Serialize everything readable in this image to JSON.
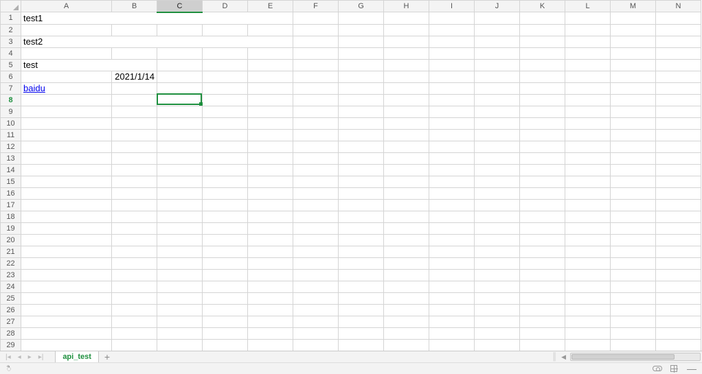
{
  "columns": [
    "A",
    "B",
    "C",
    "D",
    "E",
    "F",
    "G",
    "H",
    "I",
    "J",
    "K",
    "L",
    "M",
    "N"
  ],
  "col_widths": {
    "default": 66,
    "row_header": 30,
    "A": 132
  },
  "row_count": 29,
  "selection": {
    "col_index": 2,
    "row": 8
  },
  "cells": {
    "A1": {
      "value": "test1",
      "merge_cols": 5
    },
    "A3": {
      "value": "test2",
      "merge_cols": 5
    },
    "A5": {
      "value": "test",
      "merge_cols": 2
    },
    "B6": {
      "value": "2021/1/14",
      "align": "right"
    },
    "A7": {
      "value": "baidu",
      "link": true
    }
  },
  "sheet_tabs": {
    "active": "api_test",
    "add_label": "+"
  },
  "nav": {
    "first": "|◂",
    "prev": "◂",
    "next": "▸",
    "last": "▸|"
  },
  "status": {
    "mic_glyph": "ꣿ",
    "eye_label": "view-mode",
    "layout_label": "grid-view",
    "minus": "—"
  }
}
